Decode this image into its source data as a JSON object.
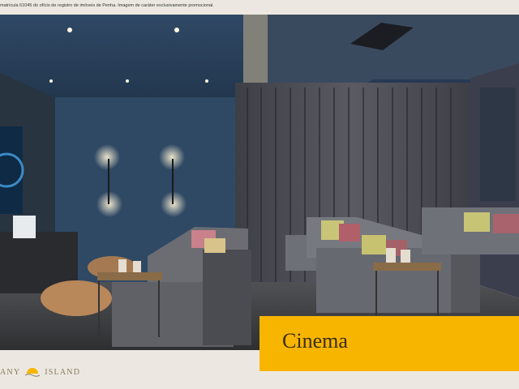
{
  "disclaimer": "matrícula 61045 do ofício de registro de imóveis de Penha. Imagem de caráter exclusivamente promocional.",
  "caption": {
    "title": "Cinema"
  },
  "brand": {
    "left_part": "ANY",
    "right_part": "ISLAND",
    "icon": "sun-wave-icon"
  },
  "colors": {
    "accent": "#f7b500",
    "wall": "#2e4660",
    "curtain": "#4a4b52",
    "floor": "#5b5a5c"
  }
}
